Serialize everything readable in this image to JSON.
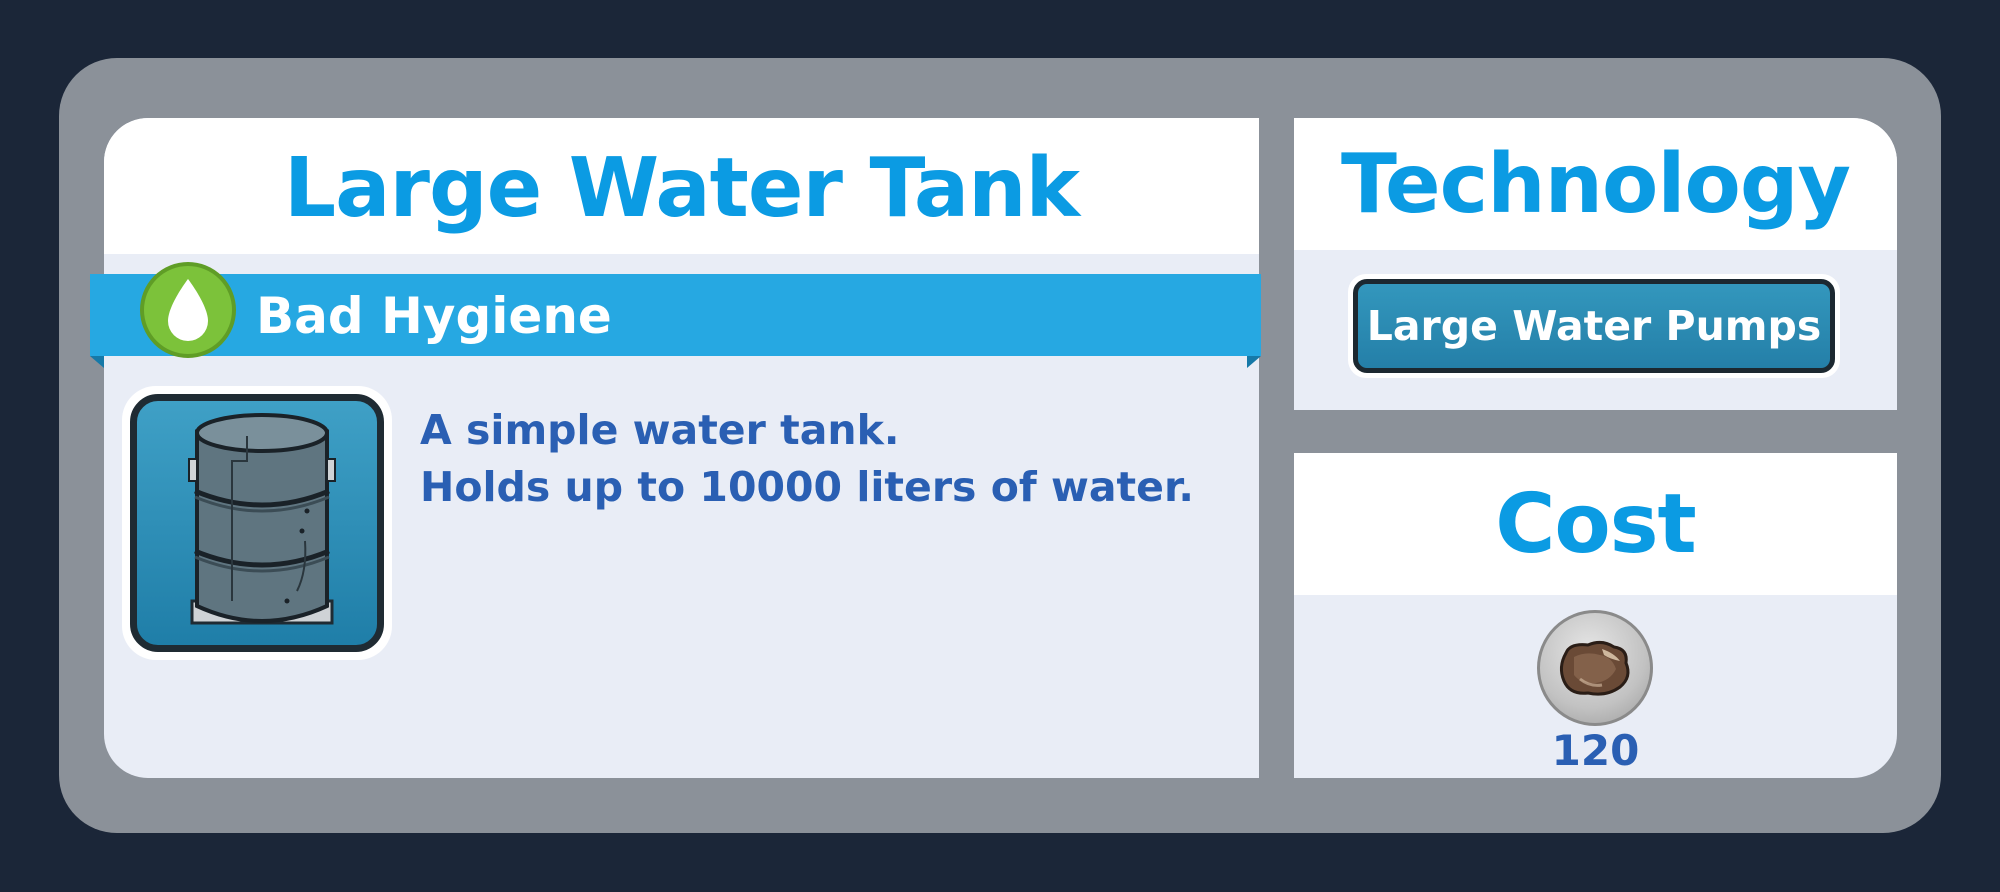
{
  "item": {
    "title": "Large Water Tank",
    "category": "Bad Hygiene",
    "category_icon": "water-drop-icon",
    "image_icon": "water-tank-icon",
    "description_lines": [
      "A simple water tank.",
      "Holds up to 10000 liters of water."
    ]
  },
  "technology": {
    "title": "Technology",
    "required_tech": "Large Water Pumps"
  },
  "cost": {
    "title": "Cost",
    "resource_icon": "stone-icon",
    "amount": "120"
  },
  "colors": {
    "title_blue": "#0b9be3",
    "ribbon_blue": "#26a8e2",
    "text_blue": "#2a5fb3",
    "hygiene_green": "#7cc23a"
  }
}
